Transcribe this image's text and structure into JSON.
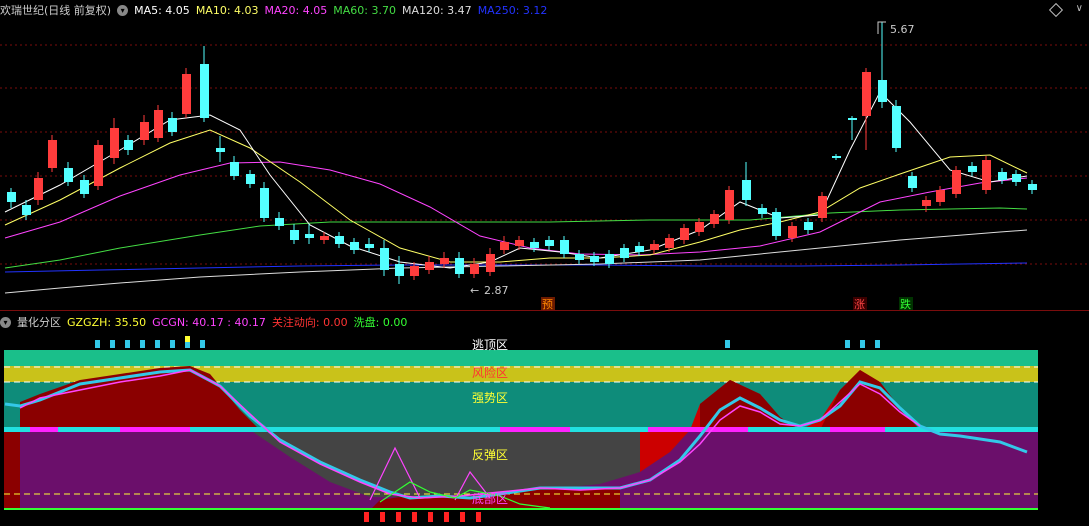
{
  "main": {
    "title": "欢瑞世纪(日线 前复权)",
    "ma": [
      {
        "label": "MA5: 4.05",
        "color": "#ffffff"
      },
      {
        "label": "MA10: 4.03",
        "color": "#ffff66"
      },
      {
        "label": "MA20: 4.05",
        "color": "#ff44ff"
      },
      {
        "label": "MA60: 3.70",
        "color": "#44dd44"
      },
      {
        "label": "MA120: 3.47",
        "color": "#dddddd"
      },
      {
        "label": "MA250: 3.12",
        "color": "#2233ff"
      }
    ],
    "high_label": "5.67",
    "low_label": "2.87",
    "markers": [
      {
        "text": "预",
        "color": "#ff8800",
        "bg": "#6b1a00"
      },
      {
        "text": "涨",
        "color": "#ff4444",
        "bg": "#3a0000"
      },
      {
        "text": "跌",
        "color": "#33ff33",
        "bg": "#003300"
      }
    ],
    "colors": {
      "up": "#ff3c3c",
      "down": "#54ffff",
      "grid": "#7a0d0d"
    }
  },
  "sub": {
    "title": "量化分区",
    "indicators": [
      {
        "label": "GZGZH: 35.50",
        "color": "#ffff33"
      },
      {
        "label": "GCGN: 40.17 : 40.17",
        "color": "#ff44ff"
      },
      {
        "label": "关注动向: 0.00",
        "color": "#ff3333"
      },
      {
        "label": "洗盘: 0.00",
        "color": "#33ff33"
      }
    ],
    "zones": {
      "top": "逃顶区",
      "risk": "风险区",
      "strong": "强势区",
      "rebound": "反弹区",
      "bottom": "底部区"
    },
    "zone_colors": {
      "top": "#1abf8a",
      "risk": "#c9c21a",
      "strong": "#0e8c7a",
      "rebound": "#444444",
      "purple": "#6b0f6b"
    }
  }
}
